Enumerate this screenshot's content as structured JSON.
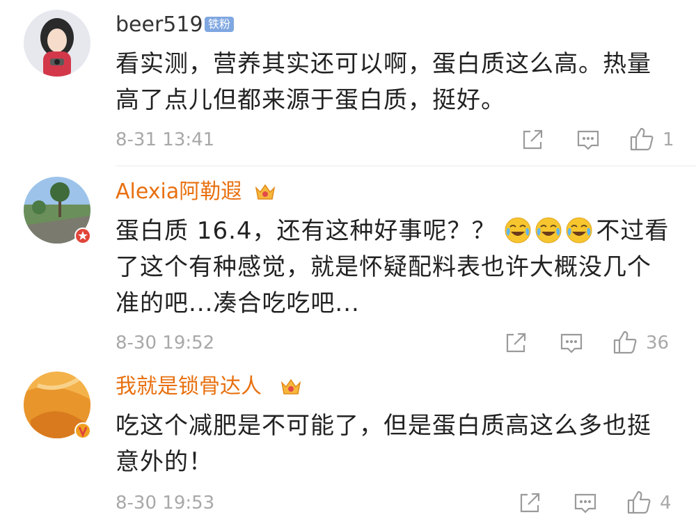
{
  "comments": [
    {
      "username": "beer519",
      "badge": "铁粉",
      "text": "看实测，营养其实还可以啊，蛋白质这么高。热量高了点儿但都来源于蛋白质，挺好。",
      "timestamp": "8-31 13:41",
      "likes": "1"
    },
    {
      "username": "Alexia阿勒遐",
      "text_before": "蛋白质 16.4，还有这种好事呢？？",
      "text_after": "不过看了这个有种感觉，就是怀疑配料表也许大概没几个准的吧...凑合吃吃吧...",
      "emojis": [
        "laugh-cry-emoji",
        "laugh-cry-emoji",
        "laugh-cry-emoji"
      ],
      "timestamp": "8-30 19:52",
      "likes": "36"
    },
    {
      "username": "我就是锁骨达人",
      "text": "吃这个减肥是不可能了，但是蛋白质高这么多也挺意外的！",
      "timestamp": "8-30 19:53",
      "likes": "4"
    }
  ],
  "icons": {
    "share": "share-icon",
    "reply": "comment-icon",
    "like": "thumbs-up-icon",
    "crown": "vip-crown-icon"
  },
  "colors": {
    "username_vip": "#e8700f",
    "badge_bg": "#7fa7e0",
    "meta": "#a8a8a8"
  }
}
